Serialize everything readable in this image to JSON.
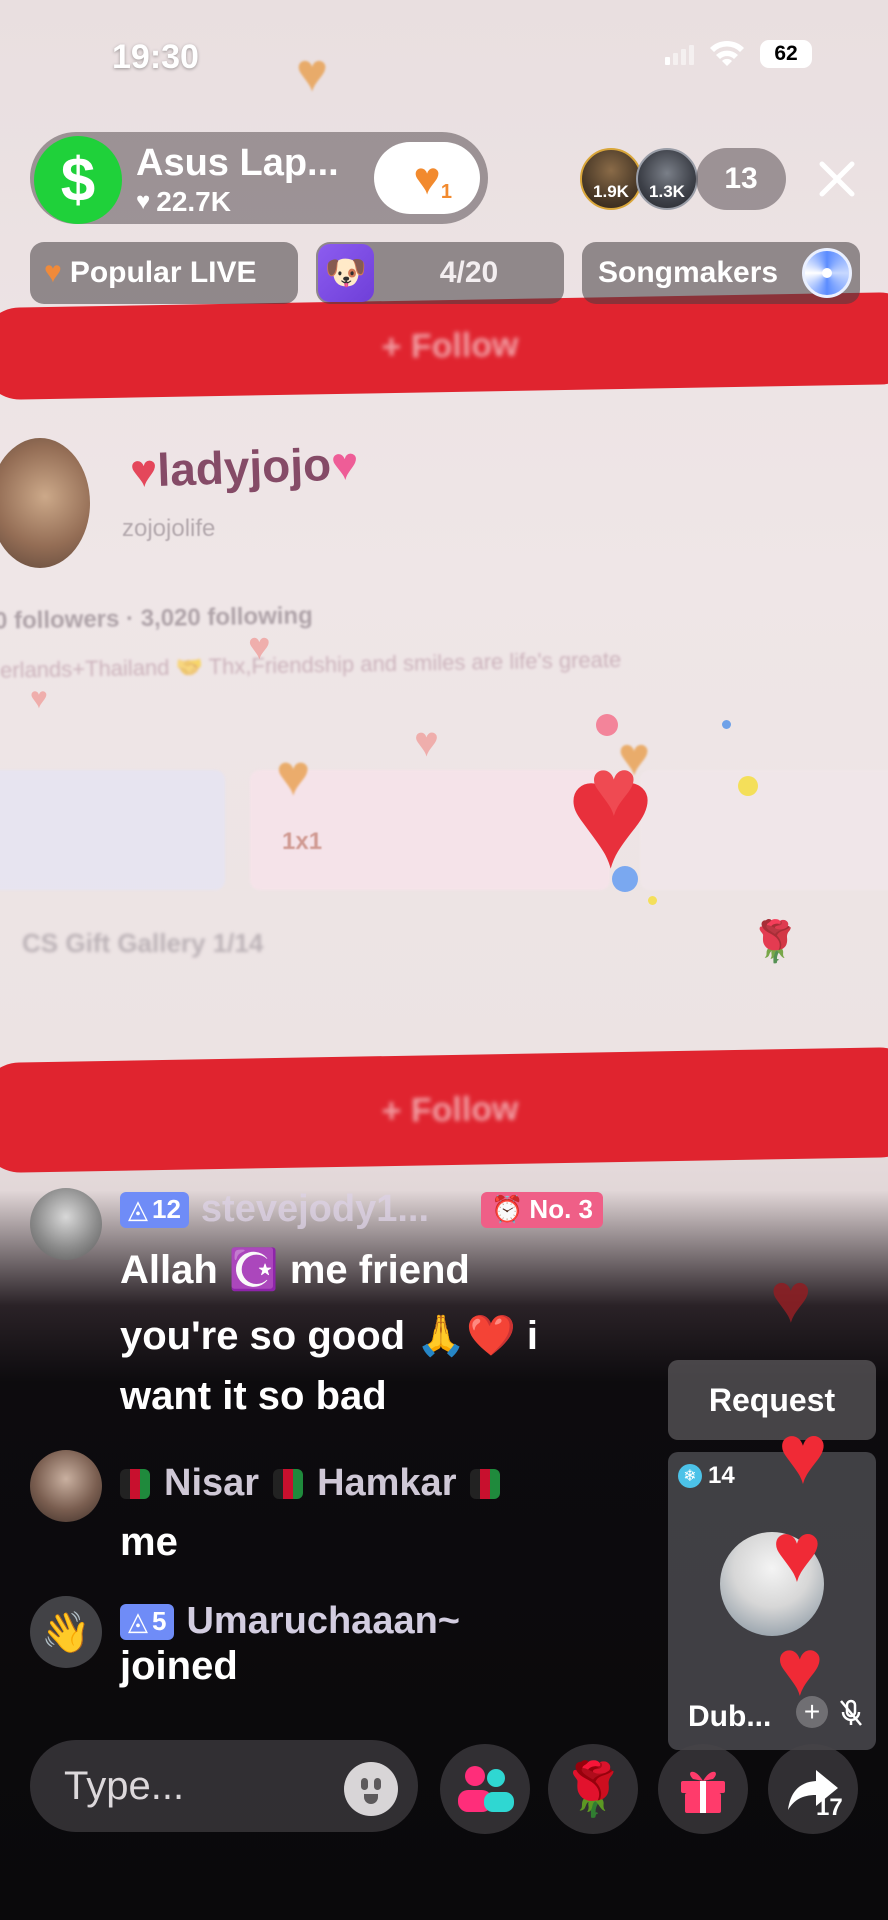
{
  "status_bar": {
    "time": "19:30",
    "battery": "62"
  },
  "host": {
    "name": "Asus Lap...",
    "likes": "22.7K",
    "follow_badge": "1"
  },
  "viewers": {
    "avatar_1_count": "1.9K",
    "avatar_2_count": "1.3K",
    "total": "13"
  },
  "chips": {
    "popular": "Popular LIVE",
    "progress": "4/20",
    "songmakers": "Songmakers"
  },
  "background": {
    "profile_name": "ladyjojo",
    "profile_handle": "zojojolife",
    "profile_stats": "0 followers · 3,020 following",
    "profile_bio": "erlands+Thailand 🤝 Thx,Friendship and smiles are life's greate",
    "follow_label": "+ Follow",
    "gallery_label": "CS Gift Gallery  1/14",
    "card_value": "1x1"
  },
  "chat": [
    {
      "level": "12",
      "username": "stevejody1...",
      "rank": "No. 3",
      "lines": [
        "Allah ☪️ me friend",
        "you're so good 🙏❤️ i",
        "want it so bad"
      ]
    },
    {
      "username_parts": [
        "Nisar",
        "Hamkar"
      ],
      "message": "me"
    },
    {
      "level": "5",
      "username": "Umaruchaaan~",
      "message": "joined"
    }
  ],
  "guest": {
    "request_label": "Request",
    "score": "14",
    "name": "Dub..."
  },
  "bottom_bar": {
    "input_placeholder": "Type...",
    "share_count": "17"
  },
  "colors": {
    "cash_green": "#1fd13a",
    "live_red": "#e0242f",
    "level_blue": "#6f8cf7",
    "rank_pink": "#ef5f87",
    "heart_red": "#e8303c"
  }
}
